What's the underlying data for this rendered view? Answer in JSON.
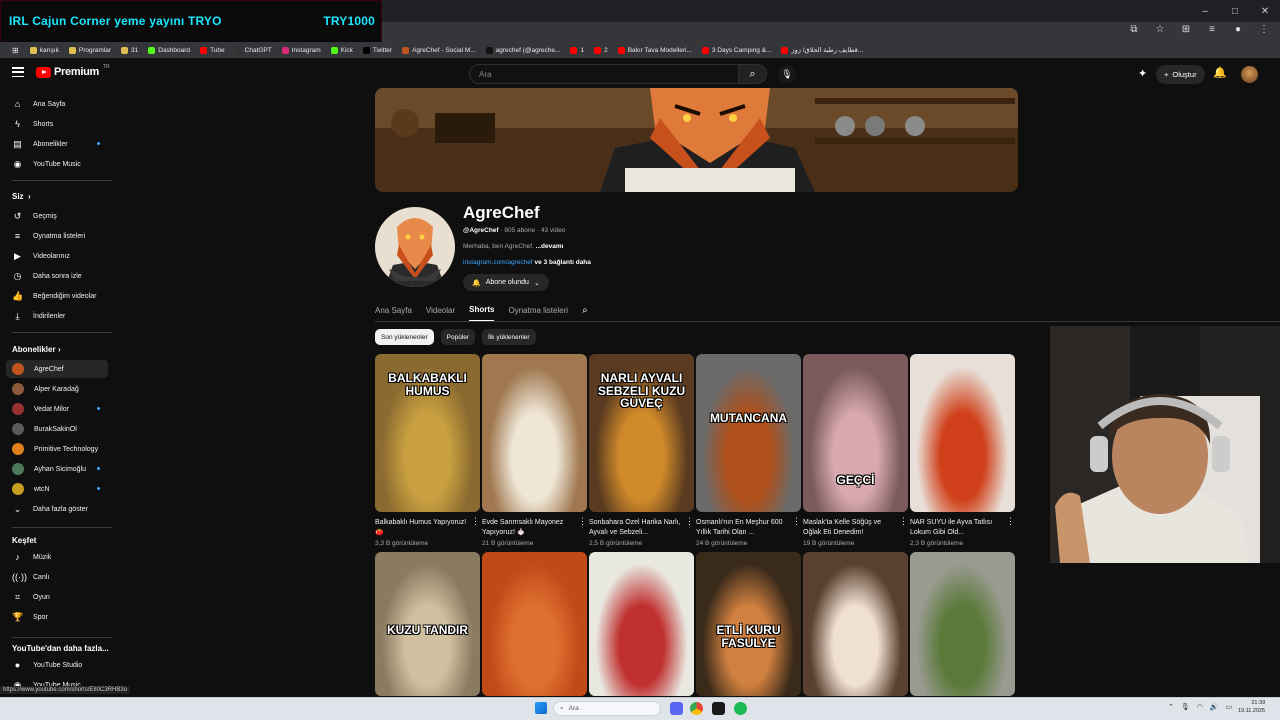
{
  "stream_overlay": {
    "text_left": "IRL Cajun Corner yeme yayını  TRYO",
    "text_right": "TRY1000"
  },
  "window_controls": [
    "–",
    "□",
    "✕"
  ],
  "bookmarks": [
    {
      "label": "karışık",
      "icon": "folder-icon"
    },
    {
      "label": "Programlar",
      "icon": "folder-icon"
    },
    {
      "label": "31",
      "icon": "folder-icon"
    },
    {
      "label": "Dashboard",
      "icon": "kick-icon"
    },
    {
      "label": "Tube",
      "icon": "youtube-icon"
    },
    {
      "label": "ChatGPT",
      "icon": "chatgpt-icon"
    },
    {
      "label": "Instagram",
      "icon": "instagram-icon"
    },
    {
      "label": "Kick",
      "icon": "kick-icon"
    },
    {
      "label": "Twitter",
      "icon": "x-icon"
    },
    {
      "label": "AgreChef - Social M...",
      "icon": "agrechef-icon"
    },
    {
      "label": "agrechef (@agreche...",
      "icon": "tiktok-icon"
    },
    {
      "label": "1",
      "icon": "youtube-icon"
    },
    {
      "label": "2",
      "icon": "youtube-icon"
    },
    {
      "label": "Bakır Tava Modelleri...",
      "icon": "youtube-icon"
    },
    {
      "label": "3 Days Camping &...",
      "icon": "youtube-icon"
    },
    {
      "label": "قطايف رطبة الحلاق/ زوز...",
      "icon": "youtube-icon"
    }
  ],
  "header": {
    "logo_text": "Premium",
    "logo_sup": "TR",
    "search_placeholder": "Ara",
    "create_label": "Oluştur"
  },
  "sidebar": {
    "main": [
      {
        "label": "Ana Sayfa",
        "icon": "home-icon"
      },
      {
        "label": "Shorts",
        "icon": "shorts-icon"
      },
      {
        "label": "Abonelikler",
        "icon": "subscriptions-icon"
      },
      {
        "label": "YouTube Music",
        "icon": "music-circle-icon"
      }
    ],
    "you_heading": "Siz",
    "you": [
      {
        "label": "Geçmiş",
        "icon": "history-icon"
      },
      {
        "label": "Oynatma listeleri",
        "icon": "playlist-icon"
      },
      {
        "label": "Videolarınız",
        "icon": "your-videos-icon"
      },
      {
        "label": "Daha sonra izle",
        "icon": "watch-later-icon"
      },
      {
        "label": "Beğendiğim videolar",
        "icon": "like-icon"
      },
      {
        "label": "İndirilenler",
        "icon": "download-icon"
      }
    ],
    "subs_heading": "Abonelikler",
    "subs": [
      {
        "label": "AgreChef",
        "color": "#c0541e",
        "dot": false
      },
      {
        "label": "Alper Karadağ",
        "color": "#8a5a3a",
        "dot": false
      },
      {
        "label": "Vedat Milor",
        "color": "#9a3030",
        "dot": true
      },
      {
        "label": "BurakSakinOl",
        "color": "#5a5a5a",
        "dot": false
      },
      {
        "label": "Primitive Technology",
        "color": "#e0801a",
        "dot": false
      },
      {
        "label": "Ayhan Sicimoğlu",
        "color": "#4a7a5a",
        "dot": true
      },
      {
        "label": "wtcN",
        "color": "#c8a020",
        "dot": true
      }
    ],
    "show_more": "Daha fazla göster",
    "explore_heading": "Keşfet",
    "explore": [
      {
        "label": "Müzik",
        "icon": "music-note-icon"
      },
      {
        "label": "Canlı",
        "icon": "live-icon"
      },
      {
        "label": "Oyun",
        "icon": "gaming-icon"
      },
      {
        "label": "Spor",
        "icon": "trophy-icon"
      }
    ],
    "more_heading": "YouTube'dan daha fazla...",
    "more": [
      {
        "label": "YouTube Studio",
        "icon": "studio-icon"
      },
      {
        "label": "YouTube Music",
        "icon": "music-circle-icon"
      }
    ]
  },
  "channel": {
    "name": "AgreChef",
    "handle": "@AgreChef",
    "meta": " · 805 abone · 43 video",
    "description": "Merhaba, ben AgreChef.",
    "more_label": "...devamı",
    "link": "instagram.com/agrechef",
    "link_more": " ve 3 bağlantı daha",
    "subscribed_label": "Abone olundu"
  },
  "tabs": [
    {
      "label": "Ana Sayfa",
      "selected": false
    },
    {
      "label": "Videolar",
      "selected": false
    },
    {
      "label": "Shorts",
      "selected": true
    },
    {
      "label": "Oynatma listeleri",
      "selected": false
    }
  ],
  "chips": [
    {
      "label": "Son yüklenenler",
      "selected": true
    },
    {
      "label": "Popüler",
      "selected": false
    },
    {
      "label": "İlk yüklenenler",
      "selected": false
    }
  ],
  "shorts_row1": [
    {
      "caption": "BALKABAKLI HUMUS",
      "title": "Balkabaklı Humus Yapıyoruz! 🍅",
      "views": "3,3 B görüntüleme",
      "bg": "#8a6a30",
      "accent": "#c9a040"
    },
    {
      "caption": "",
      "title": "Evde Sarımsaklı Mayonez Yapıyoruz! 🧄",
      "views": "21 B görüntüleme",
      "bg": "#a07850",
      "accent": "#efe6d6"
    },
    {
      "caption": "NARLI AYVALI SEBZELI KUZU GÜVEÇ",
      "title": "Sonbahara Özel Harika Narlı, Ayvalı ve Sebzeli...",
      "views": "2,5 B görüntüleme",
      "bg": "#5a3a20",
      "accent": "#d08a2a"
    },
    {
      "caption": "MUTANCANA",
      "title": "Osmanlı'nın En Meşhur 600 Yıllık Tarihi Olan ...",
      "views": "24 B görüntüleme",
      "bg": "#6a6a6a",
      "accent": "#b0501a"
    },
    {
      "caption": "GEÇCİ",
      "title": "Maslak'ta Kelle Söğüş ve Oğlak Eti Denedim!",
      "views": "19 B görüntüleme",
      "bg": "#7a5a5a",
      "accent": "#d8a8b0"
    },
    {
      "caption": "",
      "title": "NAR SUYU ile Ayva Tatlısı Lokum Gibi Old...",
      "views": "2,3 B görüntüleme",
      "bg": "#e8e0d8",
      "accent": "#d0401a"
    }
  ],
  "shorts_row2": [
    {
      "caption": "KUZU TANDIR",
      "bg": "#8a7a60",
      "accent": "#d0c0a0"
    },
    {
      "caption": "",
      "bg": "#c04a1a",
      "accent": "#e07030"
    },
    {
      "caption": "",
      "bg": "#e8e8e0",
      "accent": "#c03030"
    },
    {
      "caption": "ETLİ KURU FASULYE",
      "bg": "#3a2a1a",
      "accent": "#d08040"
    },
    {
      "caption": "",
      "bg": "#5a4030",
      "accent": "#f0e0d0"
    },
    {
      "caption": "",
      "bg": "#9a9a90",
      "accent": "#5a7a3a"
    }
  ],
  "status_url": "https://www.youtube.com/shorts/E80C3RHB3o",
  "taskbar": {
    "search_placeholder": "Ara",
    "time": "21:39",
    "date": "19.11.2025"
  }
}
